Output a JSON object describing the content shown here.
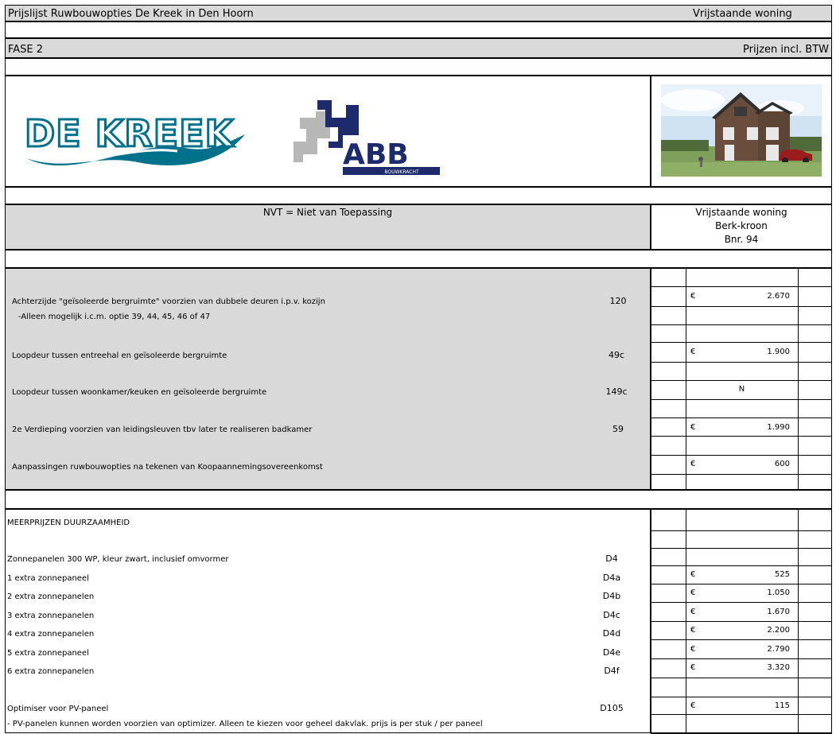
{
  "header": {
    "title": "Prijslijst Ruwbouwopties De Kreek in Den Hoorn",
    "type": "Vrijstaande woning",
    "phase": "FASE 2",
    "price_note": "Prijzen incl. BTW"
  },
  "logos": {
    "kreek": "DE KREEK",
    "abb": "ABB",
    "abb_sub": "BOUWKRACHT"
  },
  "legend": "NVT = Niet van Toepassing",
  "house": {
    "line1": "Vrijstaande woning",
    "line2": "Berk-kroon",
    "line3": "Bnr. 94"
  },
  "ruwbouw": [
    {
      "label": "Achterzijde \"geïsoleerde bergruimte\" voorzien van dubbele deuren i.p.v. kozijn",
      "code": "120",
      "price": "2.670"
    },
    {
      "label": " -Alleen mogelijk i.c.m. optie 39, 44, 45, 46 of 47"
    },
    {
      "label": "Loopdeur tussen entreehal en geïsoleerde bergruimte",
      "code": "49c",
      "price": "1.900"
    },
    {
      "label": "Loopdeur tussen woonkamer/keuken en geïsoleerde bergruimte",
      "code": "149c",
      "status": "N"
    },
    {
      "label": "2e Verdieping voorzien van leidingsleuven tbv later te realiseren badkamer",
      "code": "59",
      "price": "1.990"
    },
    {
      "label": "Aanpassingen ruwbouwopties na tekenen van Koopaannemingsovereenkomst",
      "price": "600"
    }
  ],
  "duurzaam": {
    "heading": "MEERPRIJZEN DUURZAAMHEID",
    "items": [
      {
        "label": "Zonnepanelen 300 WP, kleur zwart, inclusief omvormer",
        "code": "D4"
      },
      {
        "label": "1 extra zonnepaneel",
        "code": "D4a",
        "price": "525"
      },
      {
        "label": "2 extra zonnepanelen",
        "code": "D4b",
        "price": "1.050"
      },
      {
        "label": "3 extra zonnepanelen",
        "code": "D4c",
        "price": "1.670"
      },
      {
        "label": "4 extra zonnepanelen",
        "code": "D4d",
        "price": "2.200"
      },
      {
        "label": "5 extra zonnepaneel",
        "code": "D4e",
        "price": "2.790"
      },
      {
        "label": "6 extra zonnepanelen",
        "code": "D4f",
        "price": "3.320"
      },
      {
        "label": "Optimiser voor PV-paneel",
        "code": "D105",
        "price": "115"
      },
      {
        "label": "- PV-panelen kunnen worden voorzien van optimizer. Alleen te kiezen voor geheel dakvlak. prijs is per stuk / per paneel"
      }
    ]
  },
  "currency": "€"
}
